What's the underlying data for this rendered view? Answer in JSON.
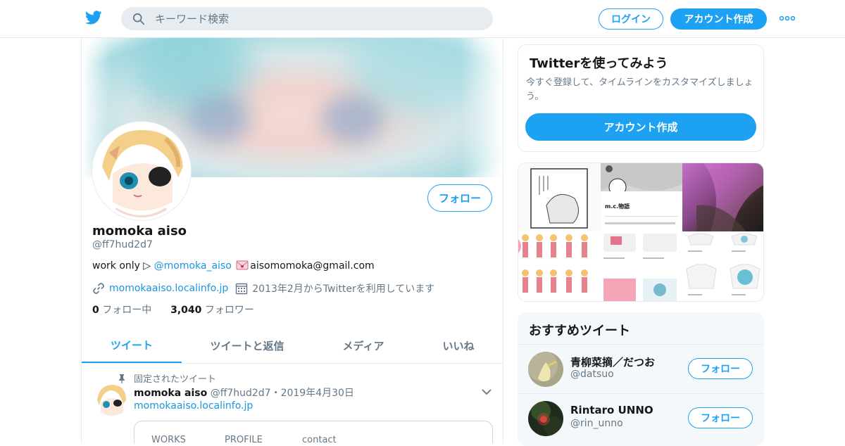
{
  "topnav": {
    "logo": "twitter-bird-icon",
    "search_placeholder": "キーワード検索",
    "login_label": "ログイン",
    "signup_label": "アカウント作成",
    "more_icon": "more-dots-icon",
    "brand_color": "#1da1f2"
  },
  "profile": {
    "name": "momoka aiso",
    "handle": "@ff7hud2d7",
    "follow_label": "フォロー",
    "bio_prefix": "work only ▷ ",
    "bio_mention": "@momoka_aiso",
    "bio_email": "aisomomoka@gmail.com",
    "website": "momokaaiso.localinfo.jp",
    "joined": "2013年2月からTwitterを利用しています",
    "following_count": "0",
    "following_label": " フォロー中",
    "followers_count": "3,040",
    "followers_label": " フォロワー"
  },
  "tabs": [
    {
      "label": "ツイート",
      "active": true
    },
    {
      "label": "ツイートと返信",
      "active": false
    },
    {
      "label": "メディア",
      "active": false
    },
    {
      "label": "いいね",
      "active": false
    }
  ],
  "pinned_tweet": {
    "pinned_label": "固定されたツイート",
    "author": "momoka aiso",
    "handle_date": " @ff7hud2d7・2019年4月30日",
    "link": "momokaaiso.localinfo.jp",
    "card_nav": [
      "WORKS",
      "PROFILE",
      "contact"
    ]
  },
  "signup_box": {
    "title": "Twitterを使ってみよう",
    "subtitle": "今すぐ登録して、タイムラインをカスタマイズしましょう。",
    "cta": "アカウント作成"
  },
  "media_text": {
    "profile_name": "m.c.物語"
  },
  "recommended": {
    "title": "おすすめツイート",
    "items": [
      {
        "name": "青柳菜摘／だつお",
        "handle": "@datsuo",
        "follow": "フォロー"
      },
      {
        "name": "Rintaro UNNO",
        "handle": "@rin_unno",
        "follow": "フォロー"
      }
    ]
  }
}
